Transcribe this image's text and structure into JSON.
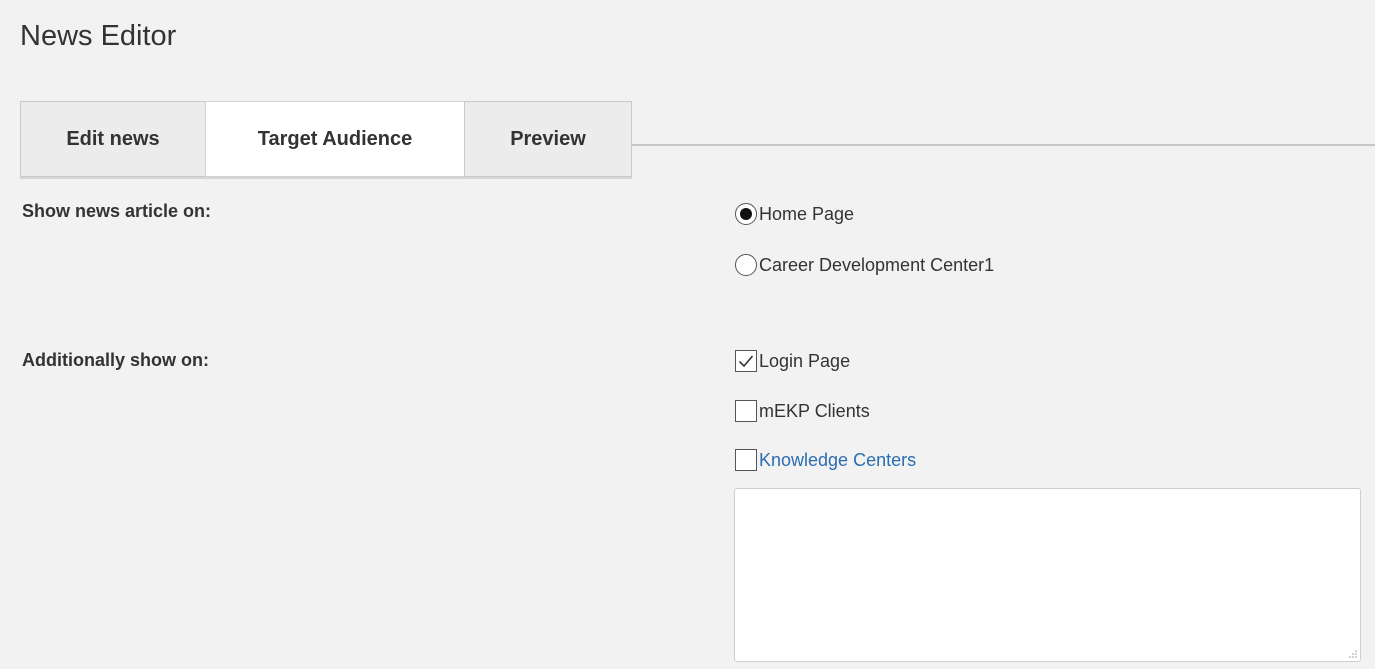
{
  "page": {
    "title": "News Editor"
  },
  "tabs": [
    {
      "label": "Edit news",
      "active": false
    },
    {
      "label": "Target Audience",
      "active": true
    },
    {
      "label": "Preview",
      "active": false
    }
  ],
  "show_on": {
    "label": "Show news article on:",
    "options": [
      {
        "label": "Home Page",
        "selected": true
      },
      {
        "label": "Career Development Center1",
        "selected": false
      }
    ]
  },
  "additionally": {
    "label": "Additionally show on:",
    "options": [
      {
        "label": "Login Page",
        "checked": true
      },
      {
        "label": "mEKP Clients",
        "checked": false
      },
      {
        "label": "Knowledge Centers",
        "checked": false,
        "is_link": true
      }
    ],
    "knowledge_centers_value": ""
  },
  "icons": {
    "radio_selected": "radio-selected-icon",
    "radio_unselected": "radio-unselected-icon",
    "checkbox_checked": "checkmark-icon",
    "resize": "resize-grip-icon"
  },
  "colors": {
    "background": "#f2f2f2",
    "link": "#2a6db0",
    "text": "#333333"
  }
}
